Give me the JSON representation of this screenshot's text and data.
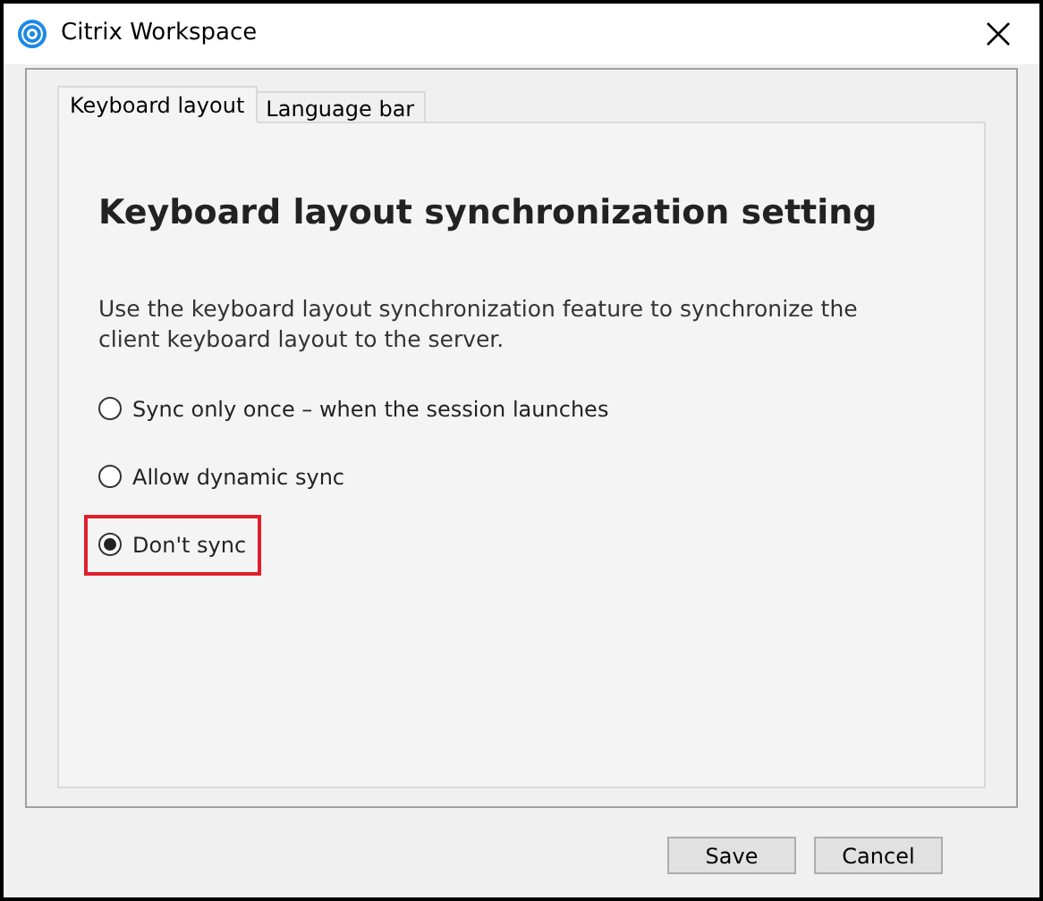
{
  "window": {
    "title": "Citrix Workspace"
  },
  "tabs": [
    {
      "label": "Keyboard layout",
      "selected": true
    },
    {
      "label": "Language bar",
      "selected": false
    }
  ],
  "panel": {
    "heading": "Keyboard layout synchronization setting",
    "description": "Use the keyboard layout synchronization feature to synchronize the client keyboard layout to the server.",
    "options": [
      {
        "label": "Sync only once – when the session launches",
        "selected": false,
        "highlighted": false
      },
      {
        "label": "Allow dynamic sync",
        "selected": false,
        "highlighted": false
      },
      {
        "label": "Don't sync",
        "selected": true,
        "highlighted": true
      }
    ]
  },
  "buttons": [
    "Save",
    "Cancel"
  ]
}
